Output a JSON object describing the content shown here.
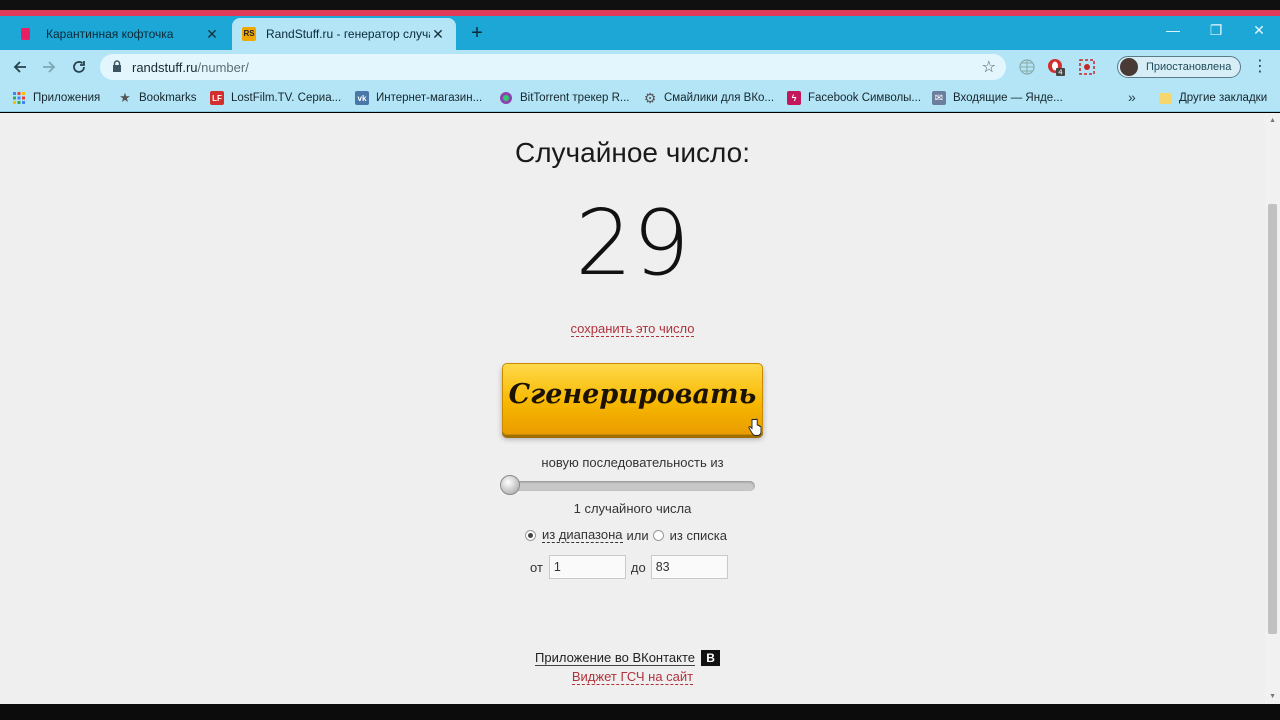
{
  "browser": {
    "tabs": [
      {
        "title": "Карантинная кофточка",
        "favicon_color": "#e91e63",
        "active": false
      },
      {
        "title": "RandStuff.ru - генератор случай",
        "favicon_color": "#f0a800",
        "active": true
      }
    ],
    "new_tab_symbol": "+",
    "window_controls": {
      "minimize": "—",
      "restore": "❐",
      "close": "✕"
    },
    "url_host": "randstuff.ru",
    "url_path": "/number/",
    "profile_status": "Приостановлена",
    "colors": {
      "accent": "#e03c5a",
      "tabstrip": "#1da7d6",
      "toolbar": "#b3e5f7"
    }
  },
  "bookmarks": {
    "items": [
      {
        "label": "Приложения",
        "icon": "apps-grid-icon",
        "color": "#4285f4"
      },
      {
        "label": "Bookmarks",
        "icon": "star-icon",
        "color": "#555555"
      },
      {
        "label": "LostFilm.TV. Сериа...",
        "icon": "lostfilm-icon",
        "color": "#d32f2f"
      },
      {
        "label": "Интернет-магазин...",
        "icon": "vk-icon",
        "color": "#4a76a8"
      },
      {
        "label": "BitTorrent трекер R...",
        "icon": "bittorrent-icon",
        "color": "#8e44ad"
      },
      {
        "label": "Смайлики для ВКо...",
        "icon": "gear-icon",
        "color": "#555555"
      },
      {
        "label": "Facebook Символы...",
        "icon": "facebook-symbols-icon",
        "color": "#c2185b"
      },
      {
        "label": "Входящие — Янде...",
        "icon": "mail-icon",
        "color": "#6d7d9c"
      }
    ],
    "more_symbol": "»",
    "other_label": "Другие закладки"
  },
  "main": {
    "heading": "Случайное число:",
    "number": "29",
    "save_link": "сохранить это число",
    "generate_button": "Сгенерировать",
    "sequence_label": "новую последовательность из",
    "slider_value_fraction": 0.0,
    "count_label": "1 случайного числа",
    "range_option": "из диапазона",
    "or_text": "или",
    "list_option": "из списка",
    "from_label": "от",
    "from_value": "1",
    "to_label": "до",
    "to_value": "83",
    "vk_app_link": "Приложение во ВКонтакте",
    "vk_badge": "В",
    "widget_link": "Виджет ГСЧ на сайт"
  }
}
